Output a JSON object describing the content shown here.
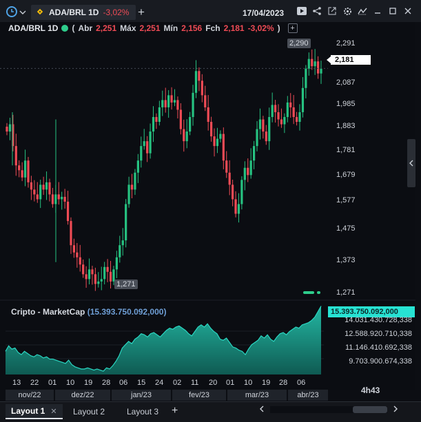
{
  "topbar": {
    "tab_symbol": "ADA/BRL 1D",
    "tab_change": "-3,02%",
    "date": "17/04/2023",
    "icons": [
      "clock-icon",
      "chevron-down-icon",
      "binance-icon",
      "plus-icon",
      "play-icon",
      "share-icon",
      "external-icon",
      "settings-icon",
      "trend-icon",
      "minimize-icon",
      "maximize-icon",
      "close-icon"
    ]
  },
  "legend": {
    "symbol": "ADA/BRL 1D",
    "open_label": "Abr",
    "open": "2,251",
    "high_label": "Máx",
    "high": "2,251",
    "low_label": "Mín",
    "low": "2,156",
    "close_label": "Fch",
    "close": "2,181",
    "change": "-3,02%",
    "paren_open": "(",
    "paren_close": ")"
  },
  "price_axis": {
    "ticks": [
      "2,291",
      "2,087",
      "1,985",
      "1,883",
      "1,781",
      "1,679",
      "1,577",
      "1,475",
      "1,373",
      "1,271"
    ],
    "current": "2,181",
    "high_marker": "2,290",
    "low_marker": "1,271"
  },
  "indicator": {
    "name": "Cripto - MarketCap",
    "value": "15.393.750.092,000",
    "paren_open": "(",
    "paren_close": ")",
    "current_badge": "15.393.750.092,000",
    "ticks": [
      "14.031.430.728,338",
      "12.588.920.710,338",
      "11.146.410.692,338",
      "9.703.900.674,338"
    ]
  },
  "x_axis": {
    "days": [
      "13",
      "22",
      "01",
      "10",
      "19",
      "28",
      "06",
      "15",
      "24",
      "02",
      "11",
      "20",
      "01",
      "10",
      "19",
      "28",
      "06"
    ],
    "months": [
      "nov/22",
      "dez/22",
      "jan/23",
      "fev/23",
      "mar/23",
      "abr/23"
    ]
  },
  "timer": "4h43",
  "layouts": {
    "tabs": [
      "Layout 1",
      "Layout 2",
      "Layout 3"
    ],
    "active": "Layout 1",
    "close_glyph": "✕"
  },
  "colors": {
    "up": "#26c281",
    "down": "#ef4b55",
    "marketcap_fill": "#1fa38f",
    "marketcap_line": "#2ad6c1",
    "background": "#0b0d12"
  },
  "chart_data": [
    {
      "type": "candlestick",
      "title": "ADA/BRL 1D",
      "ylim": [
        1.22,
        2.33
      ],
      "x_range": [
        "2022-11-13",
        "2023-04-17"
      ],
      "close": [
        1.92,
        1.95,
        1.86,
        1.78,
        1.76,
        1.73,
        1.8,
        1.71,
        1.68,
        1.66,
        1.64,
        1.7,
        1.68,
        1.71,
        1.66,
        1.62,
        1.66,
        1.64,
        1.65,
        1.63,
        1.55,
        1.45,
        1.42,
        1.4,
        1.37,
        1.33,
        1.31,
        1.35,
        1.33,
        1.29,
        1.3,
        1.31,
        1.36,
        1.34,
        1.3,
        1.35,
        1.4,
        1.45,
        1.47,
        1.62,
        1.7,
        1.68,
        1.75,
        1.8,
        1.86,
        1.88,
        1.83,
        1.92,
        1.98,
        1.96,
        2.02,
        2.05,
        2.02,
        2.07,
        2.04,
        2.05,
        2.01,
        1.93,
        1.88,
        1.92,
        1.98,
        2.08,
        2.17,
        2.13,
        2.07,
        2.02,
        1.96,
        1.9,
        1.86,
        1.89,
        1.91,
        1.8,
        1.75,
        1.7,
        1.64,
        1.58,
        1.62,
        1.72,
        1.77,
        1.74,
        1.8,
        1.86,
        1.93,
        1.97,
        1.92,
        1.88,
        1.98,
        2.03,
        2.0,
        1.97,
        1.95,
        1.98,
        2.04,
        2.02,
        1.98,
        1.96,
        2.0,
        2.1,
        2.18,
        2.22,
        2.19,
        2.21,
        2.16,
        2.18
      ]
    },
    {
      "type": "area",
      "title": "Cripto - MarketCap",
      "ylim": [
        8700000000,
        15600000000
      ],
      "values": [
        11.3,
        11.8,
        11.5,
        11.6,
        11.2,
        11.0,
        11.3,
        11.1,
        10.9,
        10.8,
        11.0,
        10.9,
        10.7,
        10.8,
        10.6,
        10.6,
        10.5,
        10.4,
        10.3,
        10.2,
        10.5,
        10.1,
        9.9,
        9.8,
        9.7,
        9.7,
        9.8,
        9.7,
        9.6,
        9.7,
        9.6,
        9.5,
        9.8,
        9.7,
        10.0,
        10.4,
        10.9,
        11.6,
        11.9,
        12.2,
        12.0,
        12.4,
        12.6,
        12.9,
        12.8,
        12.6,
        12.9,
        13.0,
        12.8,
        12.6,
        12.9,
        13.2,
        13.4,
        13.3,
        13.5,
        13.6,
        13.4,
        13.2,
        12.9,
        12.7,
        13.1,
        13.5,
        13.7,
        13.5,
        13.8,
        13.4,
        13.1,
        12.9,
        12.4,
        12.3,
        12.5,
        12.1,
        11.7,
        11.6,
        11.4,
        11.3,
        11.0,
        11.5,
        11.9,
        12.1,
        12.3,
        12.7,
        12.5,
        12.8,
        12.4,
        12.2,
        12.6,
        12.9,
        13.0,
        12.8,
        13.1,
        13.3,
        13.5,
        13.4,
        13.7,
        13.8,
        13.9,
        14.1,
        14.4,
        14.9,
        15.4
      ]
    }
  ]
}
